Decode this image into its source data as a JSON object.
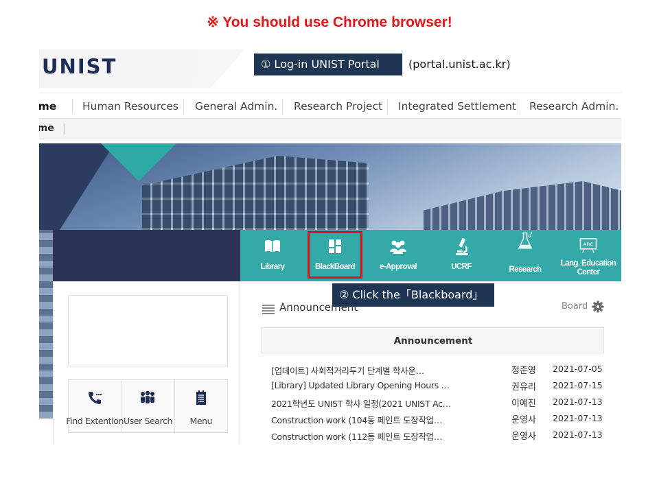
{
  "notice": "※ You should use Chrome browser!",
  "logo": "UNIST",
  "step1": {
    "label": "① Log-in UNIST Portal",
    "url": "(portal.unist.ac.kr)"
  },
  "menu": {
    "items": [
      "ome",
      "Human Resources",
      "General Admin.",
      "Research Project",
      "Integrated Settlement",
      "Research Admin."
    ],
    "subbar_home": "ome"
  },
  "quicklinks": [
    {
      "label": "Library",
      "icon": "book-icon"
    },
    {
      "label": "BlackBoard",
      "icon": "grid-icon"
    },
    {
      "label": "e-Approval",
      "icon": "people-icon"
    },
    {
      "label": "UCRF",
      "icon": "microscope-icon"
    },
    {
      "label": "Research",
      "icon": "flask-icon"
    },
    {
      "label": "Lang. Education Center",
      "icon": "abc-board-icon"
    }
  ],
  "step2": {
    "label": "② Click the「Blackboard」"
  },
  "tools": [
    {
      "label": "Find Extention",
      "icon": "phone-icon"
    },
    {
      "label": "User Search",
      "icon": "users-icon"
    },
    {
      "label": "Menu",
      "icon": "notebook-icon"
    }
  ],
  "announcement": {
    "heading": "Announcement",
    "board_link": "Board",
    "tab": "Announcement",
    "rows": [
      {
        "title": "[업데이트] 사회적거리두기 단계별 학사운…",
        "author": "정준영",
        "date": "2021-07-05"
      },
      {
        "title": "[Library] Updated Library Opening Hours …",
        "author": "권유리",
        "date": "2021-07-15"
      },
      {
        "title": "2021학년도 UNIST 학사 일정(2021 UNIST Ac…",
        "author": "이예진",
        "date": "2021-07-13"
      },
      {
        "title": "Construction work (104동 페인트 도장작업…",
        "author": "운영사",
        "date": "2021-07-13"
      },
      {
        "title": "Construction work (112동 페인트 도장작업…",
        "author": "운영사",
        "date": "2021-07-13"
      }
    ]
  },
  "colors": {
    "teal": "#34aaa8",
    "navy": "#2c3354",
    "notice_red": "#e3151a",
    "highlight_red": "#e30d17",
    "callout_bg": "#1f3554"
  }
}
